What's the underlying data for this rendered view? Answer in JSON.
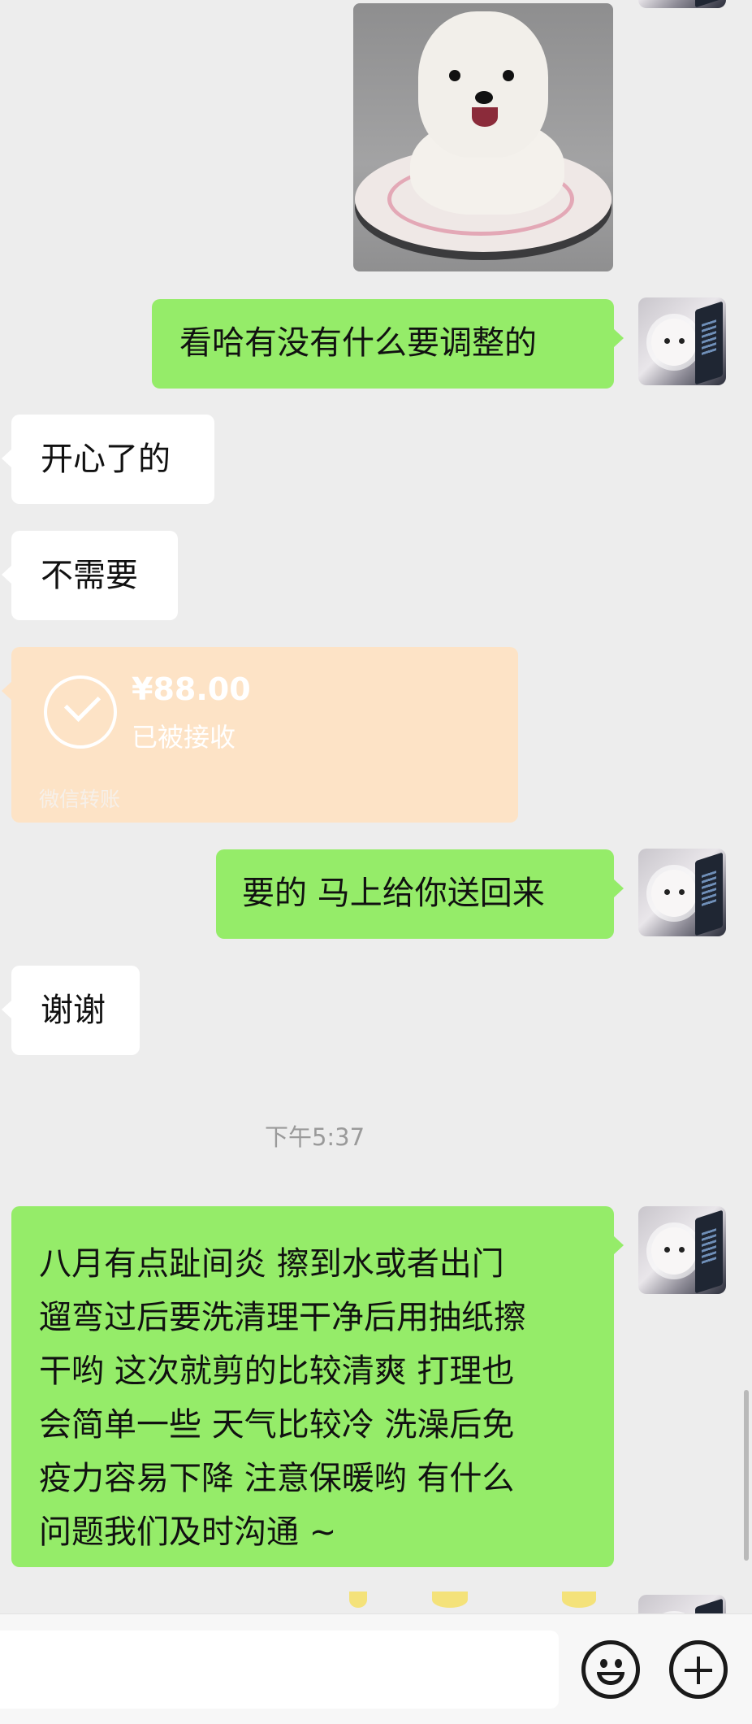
{
  "chat": {
    "messages": [
      {
        "id": "m1",
        "type": "image",
        "side": "out",
        "alt": "dog-photo"
      },
      {
        "id": "m2",
        "type": "text",
        "side": "out",
        "text": "看哈有没有什么要调整的"
      },
      {
        "id": "m3",
        "type": "text",
        "side": "in",
        "text": "开心了的"
      },
      {
        "id": "m4",
        "type": "text",
        "side": "in",
        "text": "不需要"
      },
      {
        "id": "m5",
        "type": "transfer",
        "side": "in",
        "amount": "¥88.00",
        "status": "已被接收",
        "brand": "微信转账"
      },
      {
        "id": "m6",
        "type": "text",
        "side": "out",
        "text": "要的 马上给你送回来"
      },
      {
        "id": "m7",
        "type": "text",
        "side": "in",
        "text": "谢谢"
      },
      {
        "id": "m8",
        "type": "text",
        "side": "out",
        "lines": [
          "八月有点趾间炎 擦到水或者出门",
          "遛弯过后要洗清理干净后用抽纸擦",
          "干哟 这次就剪的比较清爽 打理也",
          "会简单一些 天气比较冷 洗澡后免",
          "疫力容易下降 注意保暖哟 有什么",
          "问题我们及时沟通 ~"
        ]
      }
    ],
    "timestamp": "下午5:37"
  },
  "input_bar": {
    "placeholder": "",
    "emoji_icon": "smiley-face-icon",
    "more_icon": "plus-circle-icon"
  },
  "colors": {
    "background": "#ededed",
    "outgoing_bubble": "#95ec69",
    "incoming_bubble": "#ffffff",
    "transfer_card": "#fde3c6"
  }
}
